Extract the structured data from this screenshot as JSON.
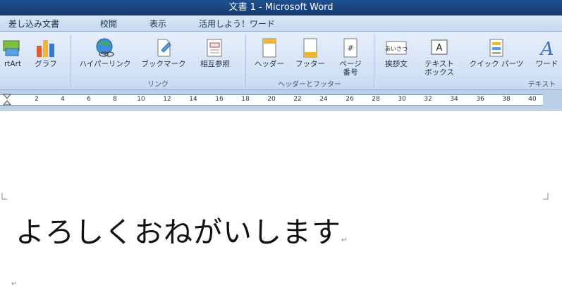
{
  "window": {
    "title": "文書 1 - Microsoft Word"
  },
  "menu": {
    "tabs": [
      "差し込み文書",
      "校閲",
      "表示",
      "活用しよう！ワード"
    ]
  },
  "ribbon": {
    "buttons": {
      "smartart": "rtArt",
      "chart": "グラフ",
      "hyperlink": "ハイパーリンク",
      "bookmark": "ブックマーク",
      "crossref": "相互参照",
      "header": "ヘッダー",
      "footer": "フッター",
      "pagenum_line1": "ページ",
      "pagenum_line2": "番号",
      "greeting": "挨拶文",
      "textbox_line1": "テキスト",
      "textbox_line2": "ボックス",
      "quickparts": "クイック パーツ",
      "wordart": "ワード"
    },
    "groups": {
      "links": "リンク",
      "header_footer": "ヘッダーとフッター",
      "text": "テキスト"
    }
  },
  "ruler": {
    "ticks": [
      "2",
      "4",
      "6",
      "8",
      "10",
      "12",
      "14",
      "16",
      "18",
      "20",
      "22",
      "24",
      "26",
      "28",
      "30",
      "32",
      "34",
      "36",
      "38",
      "40"
    ]
  },
  "document": {
    "body_text": "よろしくおねがいします",
    "paragraph_mark": "↵"
  },
  "colors": {
    "title_bar": "#163b70",
    "ribbon": "#d4e2f5",
    "ruler": "#bcd0ea"
  }
}
